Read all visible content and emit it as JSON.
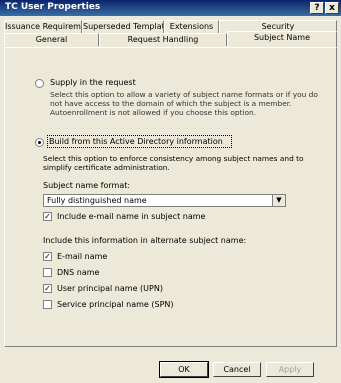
{
  "window": {
    "title": "TC User Properties",
    "help_icon": "?",
    "close_icon": "x"
  },
  "tabs_row1": [
    "Issuance Requirements",
    "Superseded Templates",
    "Extensions",
    "Security"
  ],
  "tabs_row2": [
    "General",
    "Request Handling",
    "Subject Name"
  ],
  "active_tab": "Subject Name",
  "supply": {
    "label": "Supply in the request",
    "description": "Select this option to allow a variety of subject name formats or if you do not have access to the domain of which the subject is a member. Autoenrollment is not allowed if you choose this option."
  },
  "build": {
    "label": "Build from this Active Directory information",
    "description": "Select this option to enforce consistency among subject names and to simplify certificate administration.",
    "format_label": "Subject name format:",
    "format_value": "Fully distinguished name",
    "include_email_label": "Include e-mail name in subject name",
    "alt_label": "Include this information in alternate subject name:",
    "options": [
      {
        "label": "E-mail name",
        "checked": true
      },
      {
        "label": "DNS name",
        "checked": false
      },
      {
        "label": "User principal name (UPN)",
        "checked": true
      },
      {
        "label": "Service principal name (SPN)",
        "checked": false
      }
    ]
  },
  "buttons": {
    "ok": "OK",
    "cancel": "Cancel",
    "apply": "Apply"
  }
}
